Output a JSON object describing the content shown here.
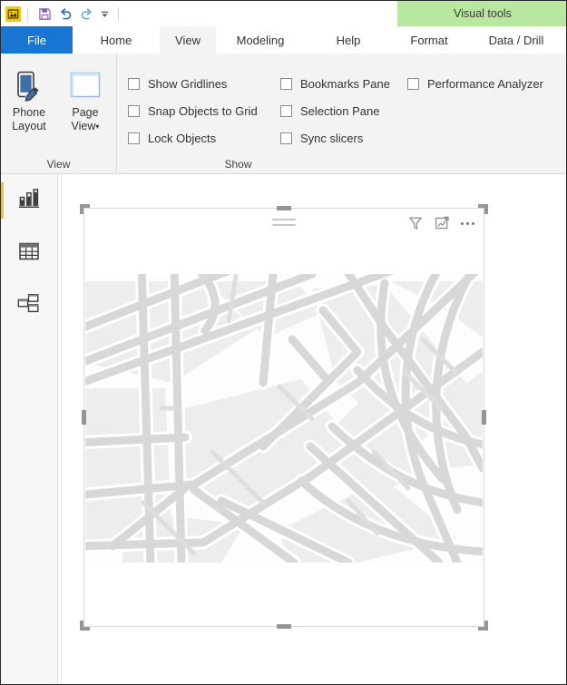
{
  "window": {
    "app_icon": "powerbi-app-icon"
  },
  "quick_access": {
    "items": [
      {
        "name": "save-icon",
        "tooltip": "Save"
      },
      {
        "name": "undo-icon",
        "tooltip": "Undo"
      },
      {
        "name": "redo-icon",
        "tooltip": "Redo"
      },
      {
        "name": "customize-quick-access-caret",
        "tooltip": "Customize Quick Access Toolbar"
      }
    ]
  },
  "contextual_group": {
    "label": "Visual tools",
    "color": "#b8e7a0"
  },
  "tabs": {
    "file": "File",
    "items": [
      {
        "label": "Home",
        "active": false
      },
      {
        "label": "View",
        "active": true
      },
      {
        "label": "Modeling",
        "active": false
      },
      {
        "label": "Help",
        "active": false
      }
    ],
    "contextual": [
      {
        "label": "Format"
      },
      {
        "label": "Data / Drill"
      }
    ],
    "file_color": "#1975d2"
  },
  "ribbon": {
    "groups": [
      {
        "name": "view",
        "label": "View",
        "buttons": [
          {
            "label_line1": "Phone",
            "label_line2": "Layout",
            "icon": "phone-layout-icon",
            "has_caret": false
          },
          {
            "label_line1": "Page",
            "label_line2": "View",
            "icon": "page-view-icon",
            "has_caret": true,
            "caret": "▾"
          }
        ]
      },
      {
        "name": "show",
        "label": "Show",
        "columns": [
          [
            {
              "label": "Show Gridlines",
              "checked": false
            },
            {
              "label": "Snap Objects to Grid",
              "checked": false
            },
            {
              "label": "Lock Objects",
              "checked": false
            }
          ],
          [
            {
              "label": "Bookmarks Pane",
              "checked": false
            },
            {
              "label": "Selection Pane",
              "checked": false
            },
            {
              "label": "Sync slicers",
              "checked": false
            }
          ],
          [
            {
              "label": "Performance Analyzer",
              "checked": false
            }
          ]
        ]
      }
    ]
  },
  "nav_rail": {
    "active_accent": "#f2c811",
    "items": [
      {
        "name": "report-view",
        "icon": "bar-chart-icon",
        "active": true
      },
      {
        "name": "data-view",
        "icon": "table-icon",
        "active": false
      },
      {
        "name": "model-view",
        "icon": "relationships-icon",
        "active": false
      }
    ]
  },
  "visual": {
    "type": "map-visual",
    "selected": true,
    "header_actions": [
      {
        "name": "filter-icon",
        "tooltip": "Filters"
      },
      {
        "name": "focus-mode-icon",
        "tooltip": "Focus mode"
      },
      {
        "name": "more-options-icon",
        "tooltip": "More options"
      }
    ],
    "drag_handle": "drag-grip-icon",
    "map": {
      "background": "#fdfdfd",
      "block_fill": "#ededed",
      "road_color": "#d8d8d8",
      "road_casing": "#ffffff"
    }
  }
}
